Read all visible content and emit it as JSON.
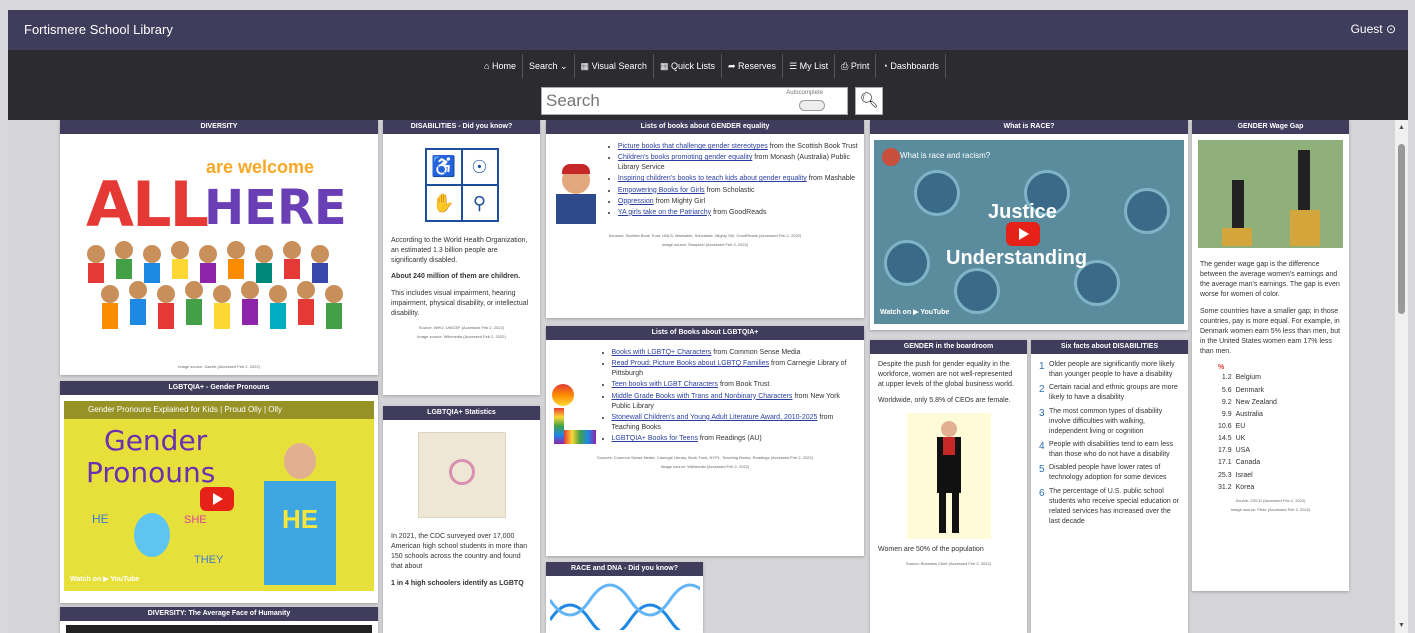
{
  "header": {
    "title": "Fortismere School Library",
    "user": "Guest"
  },
  "nav": [
    {
      "icon": "home-icon",
      "glyph": "⌂",
      "label": "Home"
    },
    {
      "icon": "",
      "glyph": "",
      "label": "Search ⌄"
    },
    {
      "icon": "visual-search-icon",
      "glyph": "▦",
      "label": "Visual Search"
    },
    {
      "icon": "quick-lists-icon",
      "glyph": "▦",
      "label": "Quick Lists"
    },
    {
      "icon": "reserves-icon",
      "glyph": "➦",
      "label": "Reserves"
    },
    {
      "icon": "my-list-icon",
      "glyph": "☰",
      "label": "My List"
    },
    {
      "icon": "print-icon",
      "glyph": "⎙",
      "label": "Print"
    },
    {
      "icon": "dashboards-icon",
      "glyph": "◔",
      "label": "Dashboards"
    }
  ],
  "search": {
    "placeholder": "Search",
    "autocomplete_label": "Autocomplete"
  },
  "panels": {
    "diversity": {
      "title": "DIVERSITY",
      "poster_text": {
        "all": "ALL",
        "welcome": "are welcome",
        "here": "HERE"
      },
      "source": "Image source: Zazzle (Accessed Feb 2, 2022)"
    },
    "pronouns": {
      "title": "LGBTQIA+ - Gender Pronouns",
      "video_title": "Gender Pronouns Explained for Kids | Proud Olly | Olly",
      "video_big1": "Gender",
      "video_big2": "Pronouns",
      "he": "HE",
      "she": "SHE",
      "they": "THEY",
      "shirt": "HE",
      "watch_on": "Watch on ▶ YouTube"
    },
    "diversity_face": {
      "title": "DIVERSITY: The Average Face of Humanity"
    },
    "disabilities": {
      "title": "DISABILITIES - Did you know?",
      "p1": "According to the World Health Organization, an estimated 1.3 billion people are significantly disabled.",
      "p2": "About 240 million of them are children.",
      "p3": "This includes visual impairment, hearing impairment, physical disability, or intellectual disability.",
      "source1": "Source: WHO, UNICEF (Accessed Feb 2, 2022)",
      "source2": "Image source: Wikimedia (Accessed Feb 2, 2022)"
    },
    "lgbt_stats": {
      "title": "LGBTQIA+ Statistics",
      "p1": "In 2021, the CDC surveyed over 17,000 American high school students in more than 150 schools across the country and found that about",
      "p2": "1 in 4 high schoolers identify as LGBTQ"
    },
    "gender_books": {
      "title": "Lists of books about GENDER equality",
      "items": [
        {
          "link": "Picture books that challenge gender stereotypes",
          "rest": " from the Scottish Book Trust"
        },
        {
          "link": "Children's books promoting gender equality",
          "rest": " from Monash (Australia) Public Library Service"
        },
        {
          "link": "Inspiring children's books to teach kids about gender equality",
          "rest": " from Mashable"
        },
        {
          "link": "Empowering Books for Girls",
          "rest": " from Scholastic"
        },
        {
          "link": "Oppression",
          "rest": " from Mighty Girl"
        },
        {
          "link": "YA girls take on the Patriarchy",
          "rest": " from GoodReads"
        }
      ],
      "source1": "Sources: Scottish Book Trust, UNLS, Mashable, Scholastic, Mighty Girl, GoodReads (Accessed Feb 2, 2022)",
      "source2": "Image source: Rawpixel (Accessed Feb 2, 2022)"
    },
    "lgbt_books": {
      "title": "Lists of Books about LGBTQIA+",
      "items": [
        {
          "link": "Books with LGBTQ+ Characters",
          "rest": " from Common Sense Media"
        },
        {
          "link": "Read Proud: Picture Books about LGBTQ Families",
          "rest": " from Carnegie Library of Pittsburgh"
        },
        {
          "link": "Teen books with LGBT Characters",
          "rest": " from Book Trust"
        },
        {
          "link": "Middle Grade Books with Trans and Nonbinary Characters",
          "rest": " from New York Public Library"
        },
        {
          "link": "Stonewall Children's and Young Adult Literature Award, 2010-2025",
          "rest": " from Teaching Books"
        },
        {
          "link": "LGBTQIA+ Books for Teens",
          "rest": " from Readings (AU)"
        }
      ],
      "source1": "Sources: Common Sense Media, Carnegie Library, Book Trust, NYPL, Teaching Books, Readings (Accessed Feb 2, 2022)",
      "source2": "Image source: Wikimedia (Accessed Feb 2, 2022)"
    },
    "race_dna": {
      "title": "RACE and DNA - Did you know?"
    },
    "race": {
      "title": "What is RACE?",
      "video_title": "What is race and racism?",
      "video_big1": "Justice",
      "video_big2": "Understanding",
      "watch_on": "Watch on ▶ YouTube"
    },
    "boardroom": {
      "title": "GENDER in the boardroom",
      "p1": "Despite the push for gender equality in the workforce, women are not well-represented at upper levels of the global business world.",
      "p2": "Worldwide, only 5.8% of CEOs are female.",
      "p3": "Women are 50% of the population",
      "source": "Source: Business Chief (Accessed Feb 2, 2022)"
    },
    "facts": {
      "title": "Six facts about DISABILITIES",
      "items": [
        "Older people are significantly more likely than younger people to have a disability",
        "Certain racial and ethnic groups are more likely to have a disability",
        "The most common types of disability involve difficulties with walking, independent living or cognition",
        "People with disabilities tend to earn less than those who do not have a disability",
        "Disabled people have lower rates of technology adoption for some devices",
        "The percentage of U.S. public school students who receive special education or related services has increased over the last decade"
      ]
    },
    "wage": {
      "title": "GENDER Wage Gap",
      "p1": "The gender wage gap is the difference between the average women's earnings and the average man's earnings. The gap is even worse for women of color.",
      "p2": "Some countries have a smaller gap; in those countries, pay is more equal. For example, in Denmark women earn 5% less than men, but in the United States women earn 17% less than men.",
      "table_header": "%",
      "rows": [
        {
          "value": "1.2",
          "country": "Belgium"
        },
        {
          "value": "5.6",
          "country": "Denmark"
        },
        {
          "value": "9.2",
          "country": "New Zealand"
        },
        {
          "value": "9.9",
          "country": "Australia"
        },
        {
          "value": "10.6",
          "country": "EU"
        },
        {
          "value": "14.5",
          "country": "UK"
        },
        {
          "value": "17.9",
          "country": "USA"
        },
        {
          "value": "17.1",
          "country": "Canada"
        },
        {
          "value": "25.3",
          "country": "Israel"
        },
        {
          "value": "31.2",
          "country": "Korea"
        }
      ],
      "source1": "Source: OECD (Accessed Feb 2, 2022)",
      "source2": "Image source: Flickr (Accessed Feb 2, 2022)"
    }
  },
  "colors": {
    "header_bg": "#3f3c5c",
    "nav_bg": "#2b2b30",
    "link": "#2a3fa0",
    "youtube_red": "#e62117"
  }
}
